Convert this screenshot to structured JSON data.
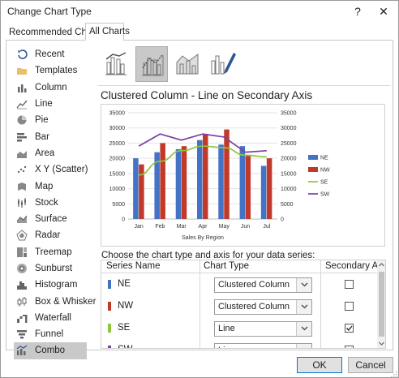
{
  "window": {
    "title": "Change Chart Type",
    "help_glyph": "?",
    "close_glyph": "✕"
  },
  "tabs": [
    {
      "label": "Recommended Charts",
      "selected": false
    },
    {
      "label": "All Charts",
      "selected": true
    }
  ],
  "sidebar": {
    "items": [
      {
        "label": "Recent",
        "icon": "recent-icon"
      },
      {
        "label": "Templates",
        "icon": "folder-icon"
      },
      {
        "label": "Column",
        "icon": "column-chart-icon"
      },
      {
        "label": "Line",
        "icon": "line-chart-icon"
      },
      {
        "label": "Pie",
        "icon": "pie-chart-icon"
      },
      {
        "label": "Bar",
        "icon": "bar-chart-icon"
      },
      {
        "label": "Area",
        "icon": "area-chart-icon"
      },
      {
        "label": "X Y (Scatter)",
        "icon": "scatter-chart-icon"
      },
      {
        "label": "Map",
        "icon": "map-chart-icon"
      },
      {
        "label": "Stock",
        "icon": "stock-chart-icon"
      },
      {
        "label": "Surface",
        "icon": "surface-chart-icon"
      },
      {
        "label": "Radar",
        "icon": "radar-chart-icon"
      },
      {
        "label": "Treemap",
        "icon": "treemap-chart-icon"
      },
      {
        "label": "Sunburst",
        "icon": "sunburst-chart-icon"
      },
      {
        "label": "Histogram",
        "icon": "histogram-chart-icon"
      },
      {
        "label": "Box & Whisker",
        "icon": "box-whisker-chart-icon"
      },
      {
        "label": "Waterfall",
        "icon": "waterfall-chart-icon"
      },
      {
        "label": "Funnel",
        "icon": "funnel-chart-icon"
      },
      {
        "label": "Combo",
        "icon": "combo-chart-icon",
        "selected": true
      }
    ]
  },
  "gallery": {
    "subtypes": [
      {
        "name": "clustered-column-line-icon"
      },
      {
        "name": "clustered-column-line-secondary-axis-icon",
        "selected": true
      },
      {
        "name": "stacked-area-clustered-column-icon"
      },
      {
        "name": "custom-combination-icon"
      }
    ],
    "subtype_title": "Clustered Column - Line on Secondary Axis"
  },
  "chart_data": {
    "type": "bar",
    "categories": [
      "Jan",
      "Feb",
      "Mar",
      "Apr",
      "May",
      "Jun",
      "Jul"
    ],
    "xlabel": "Sales By Region",
    "ylim": [
      0,
      35000
    ],
    "y_ticks": [
      "0",
      "5000",
      "10000",
      "15000",
      "20000",
      "25000",
      "30000",
      "35000"
    ],
    "y2lim": [
      0,
      35000
    ],
    "y2_ticks": [
      "0",
      "5000",
      "10000",
      "15000",
      "20000",
      "25000",
      "30000",
      "35000"
    ],
    "series": [
      {
        "name": "NE",
        "kind": "column",
        "color": "#4472C4",
        "values": [
          20000,
          22000,
          23000,
          26000,
          24500,
          24000,
          17500
        ]
      },
      {
        "name": "NW",
        "kind": "column",
        "color": "#C0392B",
        "values": [
          18000,
          25000,
          24000,
          28000,
          29500,
          21000,
          20000
        ]
      },
      {
        "name": "SE",
        "kind": "line",
        "color": "#8DC63F",
        "values": [
          14500,
          19000,
          22500,
          24000,
          23500,
          21000,
          20500
        ]
      },
      {
        "name": "SW",
        "kind": "line",
        "color": "#7E3FA3",
        "values": [
          24000,
          28000,
          26000,
          28000,
          27000,
          22000,
          22500
        ]
      }
    ],
    "legend_position": "right",
    "grid": true
  },
  "series_panel": {
    "prompt": "Choose the chart type and axis for your data series:",
    "headers": {
      "name": "Series Name",
      "type": "Chart Type",
      "axis": "Secondary Axis"
    },
    "rows": [
      {
        "name": "NE",
        "color": "#4472C4",
        "chart_type": "Clustered Column",
        "secondary": false
      },
      {
        "name": "NW",
        "color": "#C0392B",
        "chart_type": "Clustered Column",
        "secondary": false
      },
      {
        "name": "SE",
        "color": "#8DC63F",
        "chart_type": "Line",
        "secondary": true
      },
      {
        "name": "SW",
        "color": "#7E3FA3",
        "chart_type": "Line",
        "secondary": true
      }
    ]
  },
  "buttons": {
    "ok": "OK",
    "cancel": "Cancel"
  }
}
